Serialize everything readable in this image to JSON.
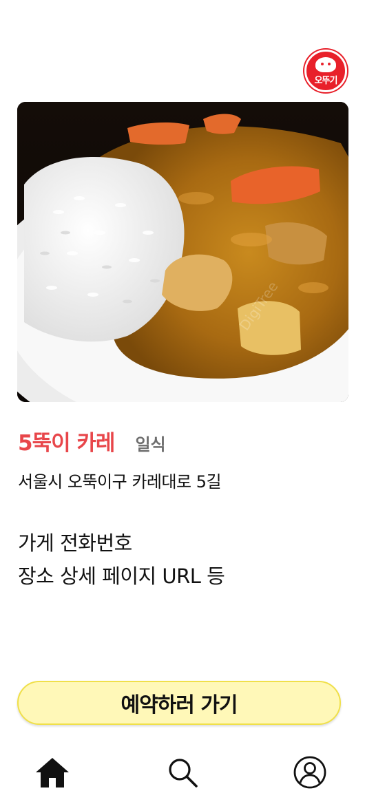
{
  "brand": {
    "logo_text": "오뚜기",
    "brand_color": "#e8202a"
  },
  "store": {
    "name": "5뚝이 카레",
    "category": "일식",
    "address": "서울시 오뚝이구 카레대로 5길",
    "info_line1": "가게 전화번호",
    "info_line2": "장소 상세 페이지 URL 등",
    "name_color": "#e8464a",
    "image_watermark": "DigiTree"
  },
  "actions": {
    "reserve_label": "예약하러 가기",
    "reserve_bg": "#fff8b8"
  },
  "nav": {
    "items": [
      {
        "icon": "home-icon"
      },
      {
        "icon": "search-icon"
      },
      {
        "icon": "profile-icon"
      }
    ]
  }
}
